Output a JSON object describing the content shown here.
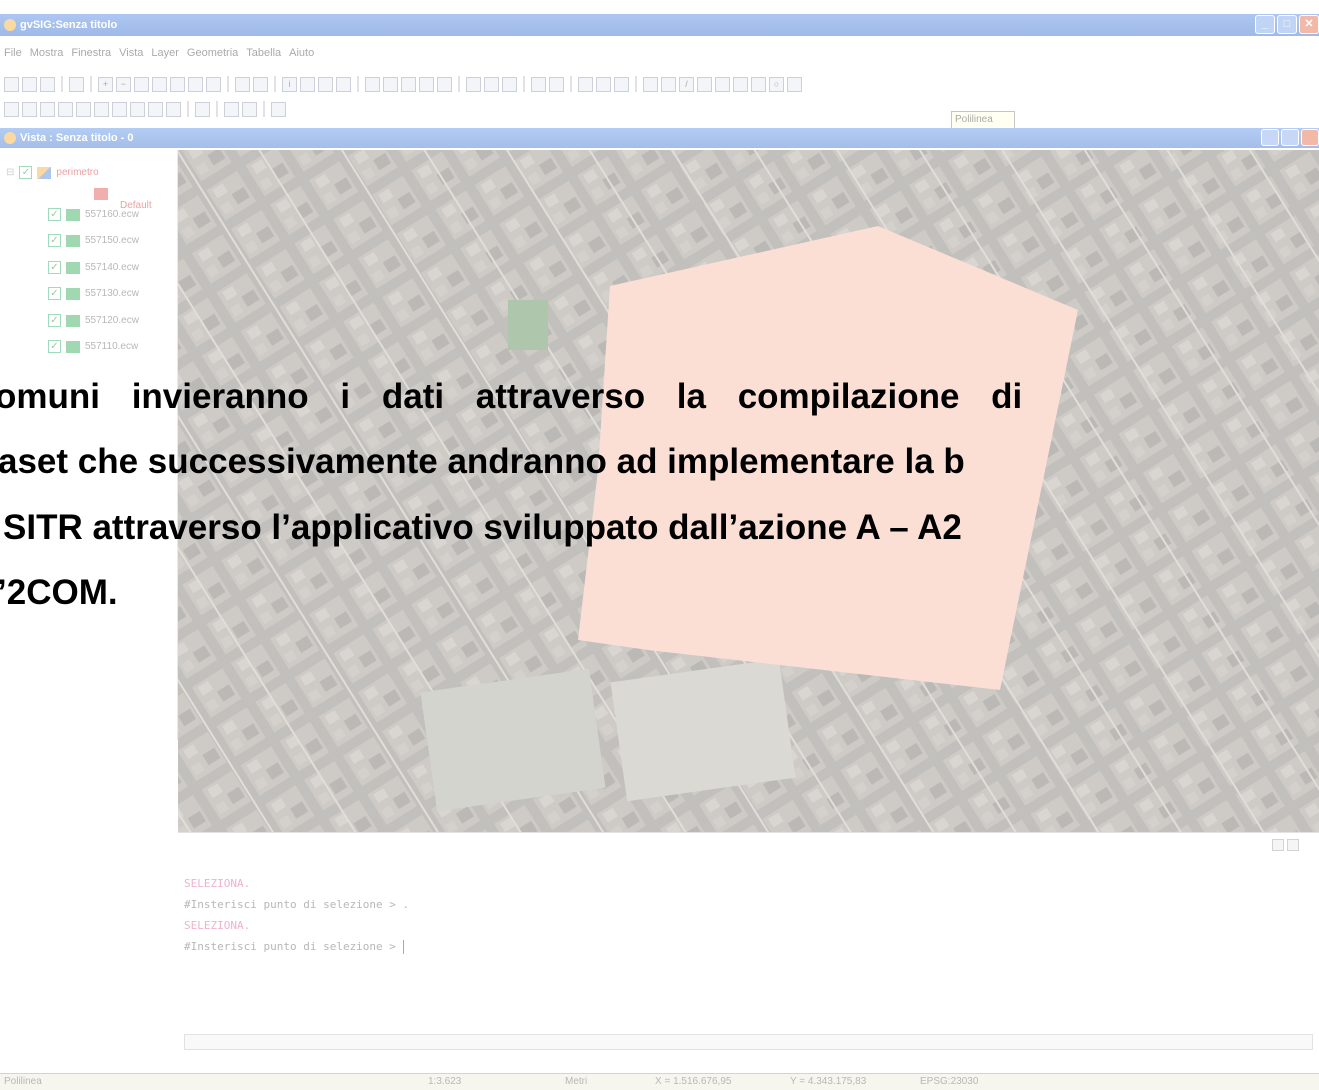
{
  "window": {
    "title": "gvSIG:Senza titolo"
  },
  "menu": [
    "File",
    "Mostra",
    "Finestra",
    "Vista",
    "Layer",
    "Geometria",
    "Tabella",
    "Aiuto"
  ],
  "tooltip": "Polilinea",
  "view": {
    "title": "Vista : Senza titolo - 0"
  },
  "toc": {
    "layer_group": "perimetro",
    "legend_default": "Default",
    "layers": [
      "557160.ecw",
      "557150.ecw",
      "557140.ecw",
      "557130.ecw",
      "557120.ecw",
      "557110.ecw"
    ]
  },
  "console": {
    "lines": [
      "SELEZIONA.",
      "#Insterisci punto di selezione > .",
      "SELEZIONA.",
      "#Insterisci punto di selezione >"
    ]
  },
  "statusbar": {
    "tool": "Polilinea",
    "scale": "1:3.623",
    "units": "Metri",
    "x": "X = 1.516.676,95",
    "y": "Y = 4.343.175,83",
    "epsg": "EPSG:23030"
  },
  "overlay_text": {
    "line1": "omuni invieranno i dati attraverso la compilazione di",
    "line2": "aset che successivamente andranno ad implementare la b",
    "line3": "SITR attraverso l’applicativo sviluppato dall’azione A – A2",
    "line4": "’2COM."
  },
  "colors": {
    "polygon": "#f6b49c",
    "pink_console": "#d84a8a",
    "titlebar": "#2a66cc"
  }
}
